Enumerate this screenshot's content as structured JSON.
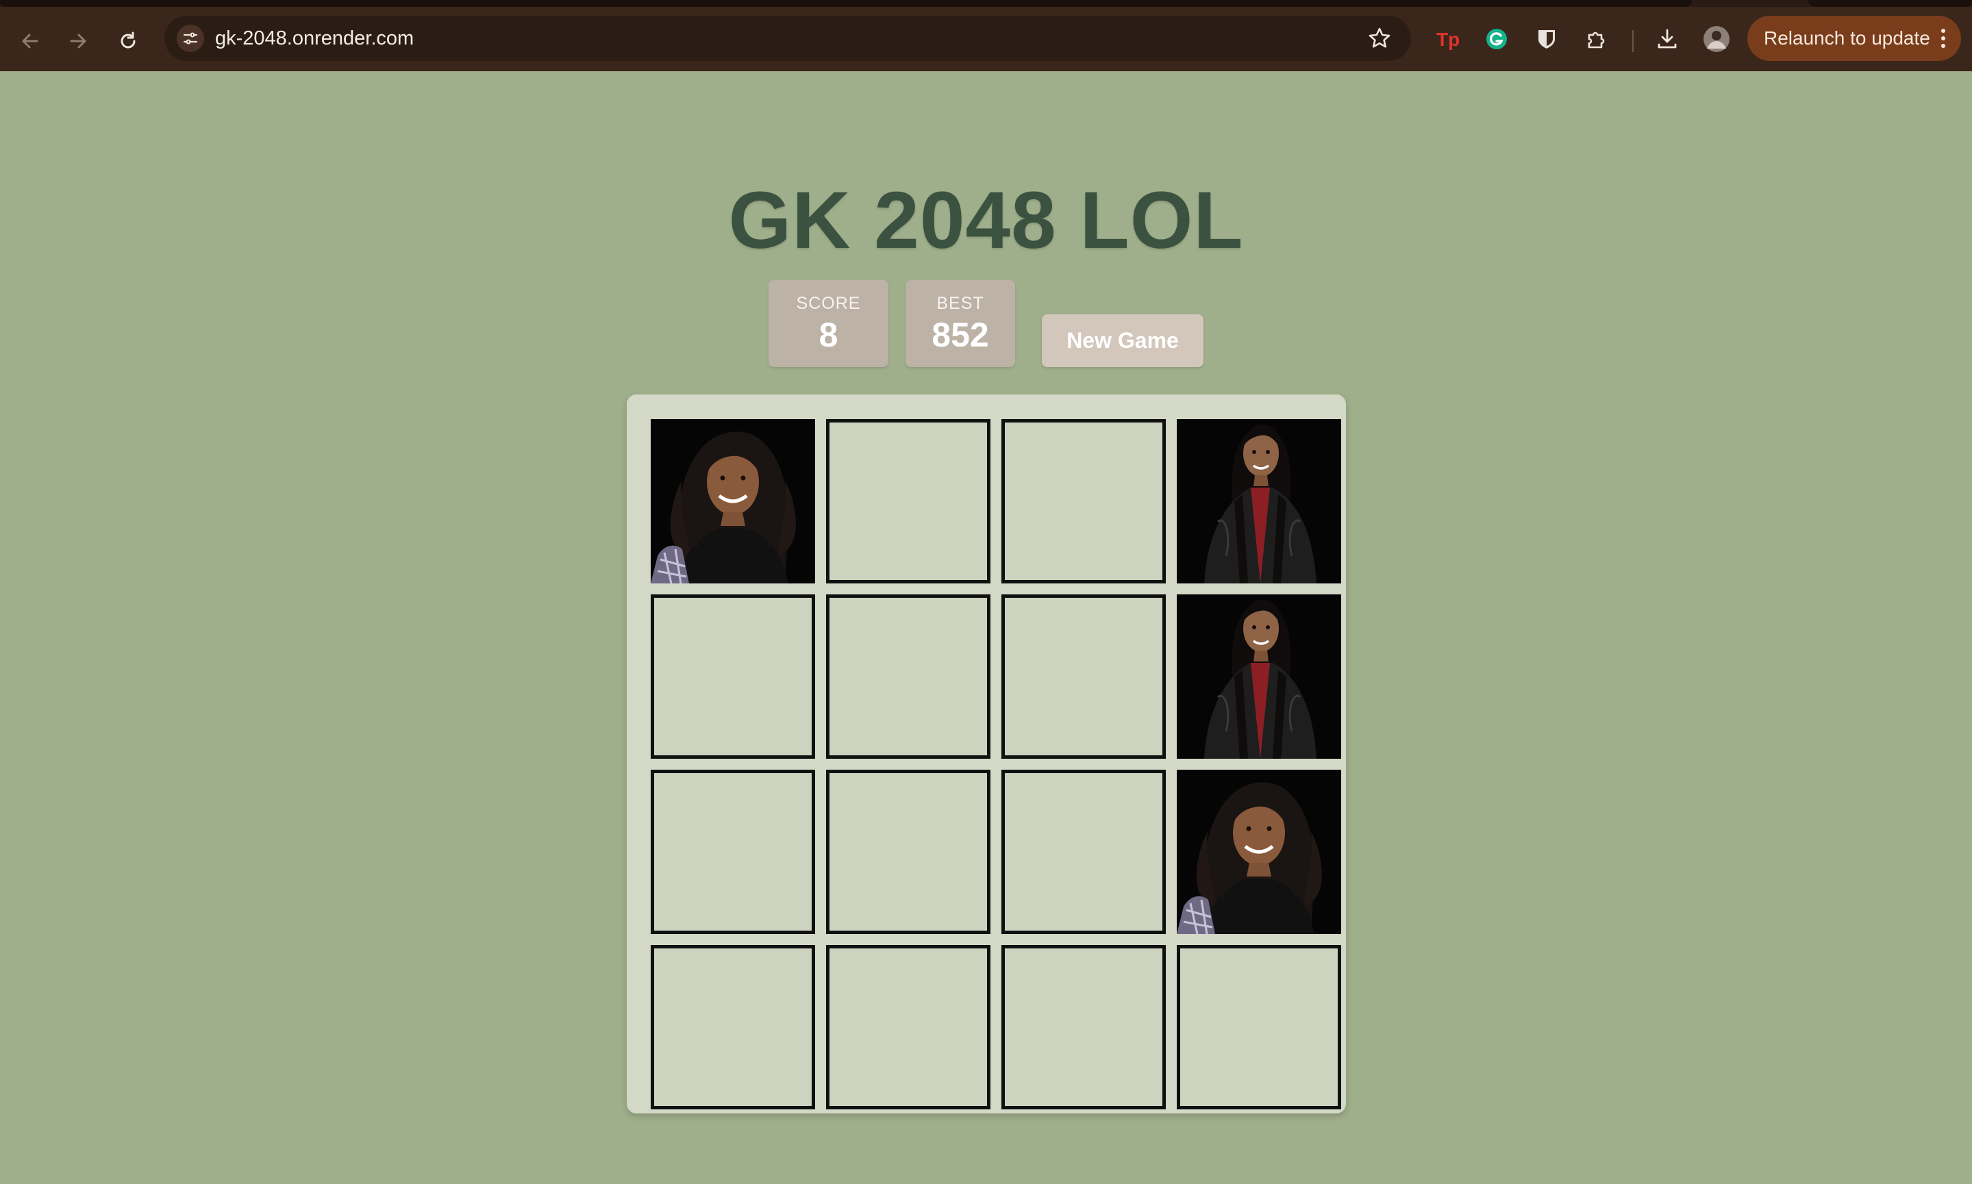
{
  "browser": {
    "url": "gk-2048.onrender.com",
    "relaunch_label": "Relaunch to update",
    "extension_icons": [
      "tp-extension-icon",
      "grammarly-icon",
      "bitwarden-icon",
      "extensions-puzzle-icon"
    ]
  },
  "game": {
    "title": "GK 2048 LOL",
    "score_label": "SCORE",
    "score_value": "8",
    "best_label": "BEST",
    "best_value": "852",
    "new_game_label": "New Game",
    "grid": [
      [
        "photo-curly",
        "",
        "",
        "photo-straight"
      ],
      [
        "",
        "",
        "",
        "photo-straight"
      ],
      [
        "",
        "",
        "",
        "photo-curly"
      ],
      [
        "",
        "",
        "",
        ""
      ]
    ]
  },
  "colors": {
    "background": "#a0af8b",
    "title": "#3b5240",
    "score_box": "#bdb2a6",
    "new_game": "#d2c7ba",
    "board": "#d3d9c6",
    "empty_cell": "#ccd4c0",
    "relaunch": "#7a3d1b"
  }
}
